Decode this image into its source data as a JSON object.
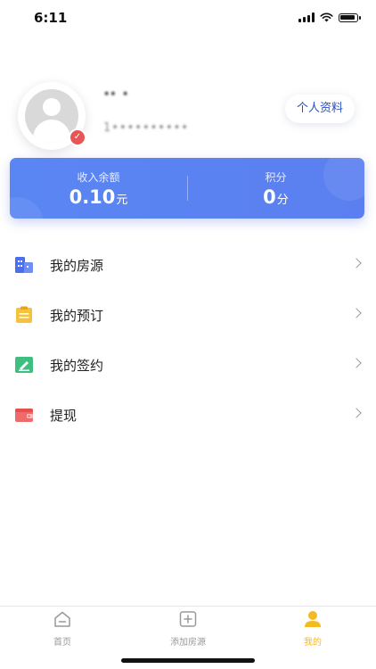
{
  "status_bar": {
    "time": "6:11"
  },
  "profile": {
    "name": "·· ·",
    "phone": "1••••••••••",
    "profile_button": "个人资料"
  },
  "balance": {
    "income_label": "收入余额",
    "income_value": "0.10",
    "income_unit": "元",
    "points_label": "积分",
    "points_value": "0",
    "points_unit": "分"
  },
  "menu": [
    {
      "label": "我的房源",
      "icon": "building-icon",
      "color": "#4a6ff0"
    },
    {
      "label": "我的预订",
      "icon": "clipboard-icon",
      "color": "#f6c23e"
    },
    {
      "label": "我的签约",
      "icon": "sign-icon",
      "color": "#3fbf7f"
    },
    {
      "label": "提现",
      "icon": "wallet-icon",
      "color": "#f06a6a"
    }
  ],
  "tabbar": [
    {
      "label": "首页",
      "icon": "home-icon"
    },
    {
      "label": "添加房源",
      "icon": "add-icon"
    },
    {
      "label": "我的",
      "icon": "user-icon",
      "active": true
    }
  ],
  "colors": {
    "accent": "#5b84f2",
    "active_tab": "#f5b921",
    "verified": "#e85555"
  }
}
